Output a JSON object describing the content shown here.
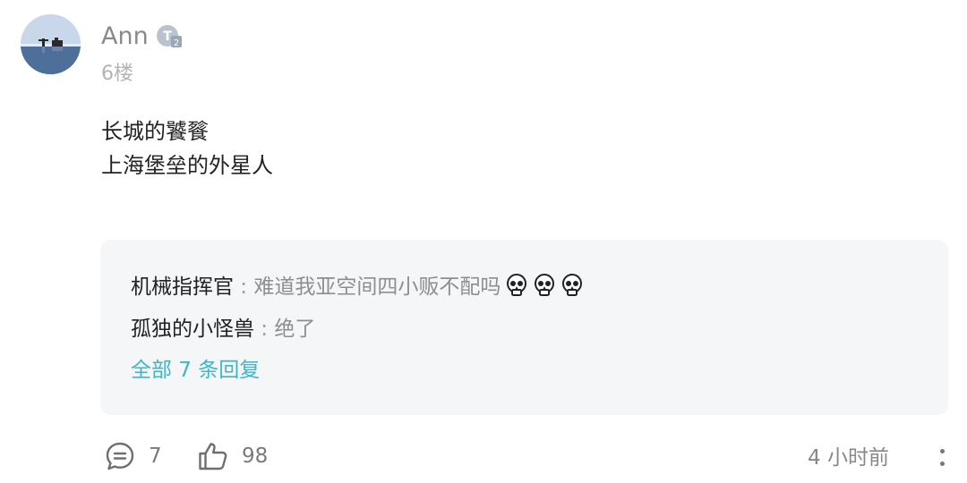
{
  "comment": {
    "username": "Ann",
    "level_badge": "T2",
    "floor": "6楼",
    "content_lines": [
      "长城的饕餮",
      "上海堡垒的外星人"
    ]
  },
  "replies": [
    {
      "author": "机械指挥官",
      "separator": " : ",
      "text": "难道我亚空间四小贩不配吗",
      "emojis": [
        "skull-emoji",
        "skull-emoji",
        "skull-emoji"
      ]
    },
    {
      "author": "孤独的小怪兽",
      "separator": " : ",
      "text": "绝了",
      "emojis": []
    }
  ],
  "all_replies_label": "全部 7 条回复",
  "actions": {
    "comment_count": "7",
    "like_count": "98",
    "time": "4 小时前"
  },
  "colors": {
    "link": "#3eb6c5",
    "reply_bg": "#f5f6f7"
  }
}
